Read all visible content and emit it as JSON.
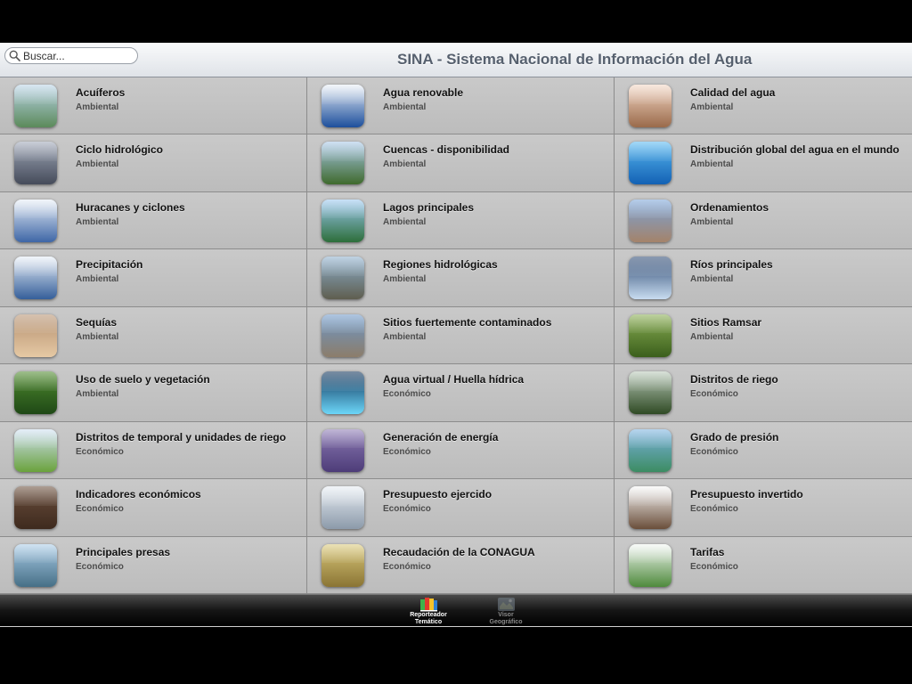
{
  "header": {
    "search_placeholder": "Buscar...",
    "title": "SINA - Sistema Nacional de Información del Agua"
  },
  "items": [
    {
      "title": "Acuíferos",
      "category": "Ambiental",
      "icon": "aquifer-thumbnail",
      "c1": "#b9d3e6",
      "c2": "#5b8a5a"
    },
    {
      "title": "Agua renovable",
      "category": "Ambiental",
      "icon": "globe-water-thumbnail",
      "c1": "#e8eef6",
      "c2": "#1d4f9c"
    },
    {
      "title": "Calidad del agua",
      "category": "Ambiental",
      "icon": "drinking-water-thumbnail",
      "c1": "#f2d6c4",
      "c2": "#9a6a4a"
    },
    {
      "title": "Ciclo hidrológico",
      "category": "Ambiental",
      "icon": "storm-cloud-thumbnail",
      "c1": "#9ea6b6",
      "c2": "#454b5a"
    },
    {
      "title": "Cuencas - disponibilidad",
      "category": "Ambiental",
      "icon": "river-basin-thumbnail",
      "c1": "#a8c7e8",
      "c2": "#3f6a2c"
    },
    {
      "title": "Distribución global del agua en el mundo",
      "category": "Ambiental",
      "icon": "earth-water-thumbnail",
      "c1": "#58b8f0",
      "c2": "#1361b4"
    },
    {
      "title": "Huracanes y ciclones",
      "category": "Ambiental",
      "icon": "hurricane-thumbnail",
      "c1": "#e6edf6",
      "c2": "#3e66a6"
    },
    {
      "title": "Lagos principales",
      "category": "Ambiental",
      "icon": "lake-thumbnail",
      "c1": "#9cc8f0",
      "c2": "#2d6e3a"
    },
    {
      "title": "Ordenamientos",
      "category": "Ambiental",
      "icon": "dry-land-thumbnail",
      "c1": "#7aa4d8",
      "c2": "#a4836a"
    },
    {
      "title": "Precipitación",
      "category": "Ambiental",
      "icon": "rain-clouds-thumbnail",
      "c1": "#e6edf6",
      "c2": "#355f9a"
    },
    {
      "title": "Regiones hidrológicas",
      "category": "Ambiental",
      "icon": "stream-thumbnail",
      "c1": "#8caecb",
      "c2": "#5f5e4f"
    },
    {
      "title": "Ríos principales",
      "category": "Ambiental",
      "icon": "waterfall-thumbnail",
      "c1": "#2a4670",
      "c2": "#c8dcf0"
    },
    {
      "title": "Sequías",
      "category": "Ambiental",
      "icon": "drought-thumbnail",
      "c1": "#b49070",
      "c2": "#e6c9a4"
    },
    {
      "title": "Sitios fuertemente contaminados",
      "category": "Ambiental",
      "icon": "polluted-river-thumbnail",
      "c1": "#6e98c8",
      "c2": "#8c7d6a"
    },
    {
      "title": "Sitios Ramsar",
      "category": "Ambiental",
      "icon": "bamboo-forest-thumbnail",
      "c1": "#88ac52",
      "c2": "#3b5f1c"
    },
    {
      "title": "Uso de suelo y vegetación",
      "category": "Ambiental",
      "icon": "waterfall-plants-thumbnail",
      "c1": "#4f8a2e",
      "c2": "#1f4816"
    },
    {
      "title": "Agua virtual / Huella hídrica",
      "category": "Económico",
      "icon": "water-drop-thumbnail",
      "c1": "#0c2e55",
      "c2": "#6cd6f8"
    },
    {
      "title": "Distritos de riego",
      "category": "Económico",
      "icon": "irrigation-thumbnail",
      "c1": "#b8c8b8",
      "c2": "#2f4a24"
    },
    {
      "title": "Distritos de temporal y unidades de riego",
      "category": "Económico",
      "icon": "sprinkler-field-thumbnail",
      "c1": "#cfe0f2",
      "c2": "#6aa23c"
    },
    {
      "title": "Generación de energía",
      "category": "Económico",
      "icon": "power-tower-thumbnail",
      "c1": "#8c7ab4",
      "c2": "#4d3c78"
    },
    {
      "title": "Grado de presión",
      "category": "Económico",
      "icon": "city-canal-thumbnail",
      "c1": "#7cb2e0",
      "c2": "#3c8c62"
    },
    {
      "title": "Indicadores económicos",
      "category": "Económico",
      "icon": "market-thumbnail",
      "c1": "#6a4e3c",
      "c2": "#3e2a1e"
    },
    {
      "title": "Presupuesto ejercido",
      "category": "Económico",
      "icon": "documents-coins-thumbnail",
      "c1": "#e6ecf2",
      "c2": "#8c9aaa"
    },
    {
      "title": "Presupuesto invertido",
      "category": "Económico",
      "icon": "calculator-thumbnail",
      "c1": "#f6f6f6",
      "c2": "#6a4e3a"
    },
    {
      "title": "Principales presas",
      "category": "Económico",
      "icon": "dam-thumbnail",
      "c1": "#a9cbe6",
      "c2": "#466f86"
    },
    {
      "title": "Recaudación de la CONAGUA",
      "category": "Económico",
      "icon": "office-counter-thumbnail",
      "c1": "#d9c87a",
      "c2": "#8a7434"
    },
    {
      "title": "Tarifas",
      "category": "Económico",
      "icon": "money-plant-thumbnail",
      "c1": "#f2f6f2",
      "c2": "#4e8a3c"
    }
  ],
  "tabs": [
    {
      "label": "Reporteador\nTemático",
      "icon": "book-report-icon",
      "active": true
    },
    {
      "label": "Visor\nGeográfico",
      "icon": "map-viewer-icon",
      "active": false
    }
  ]
}
